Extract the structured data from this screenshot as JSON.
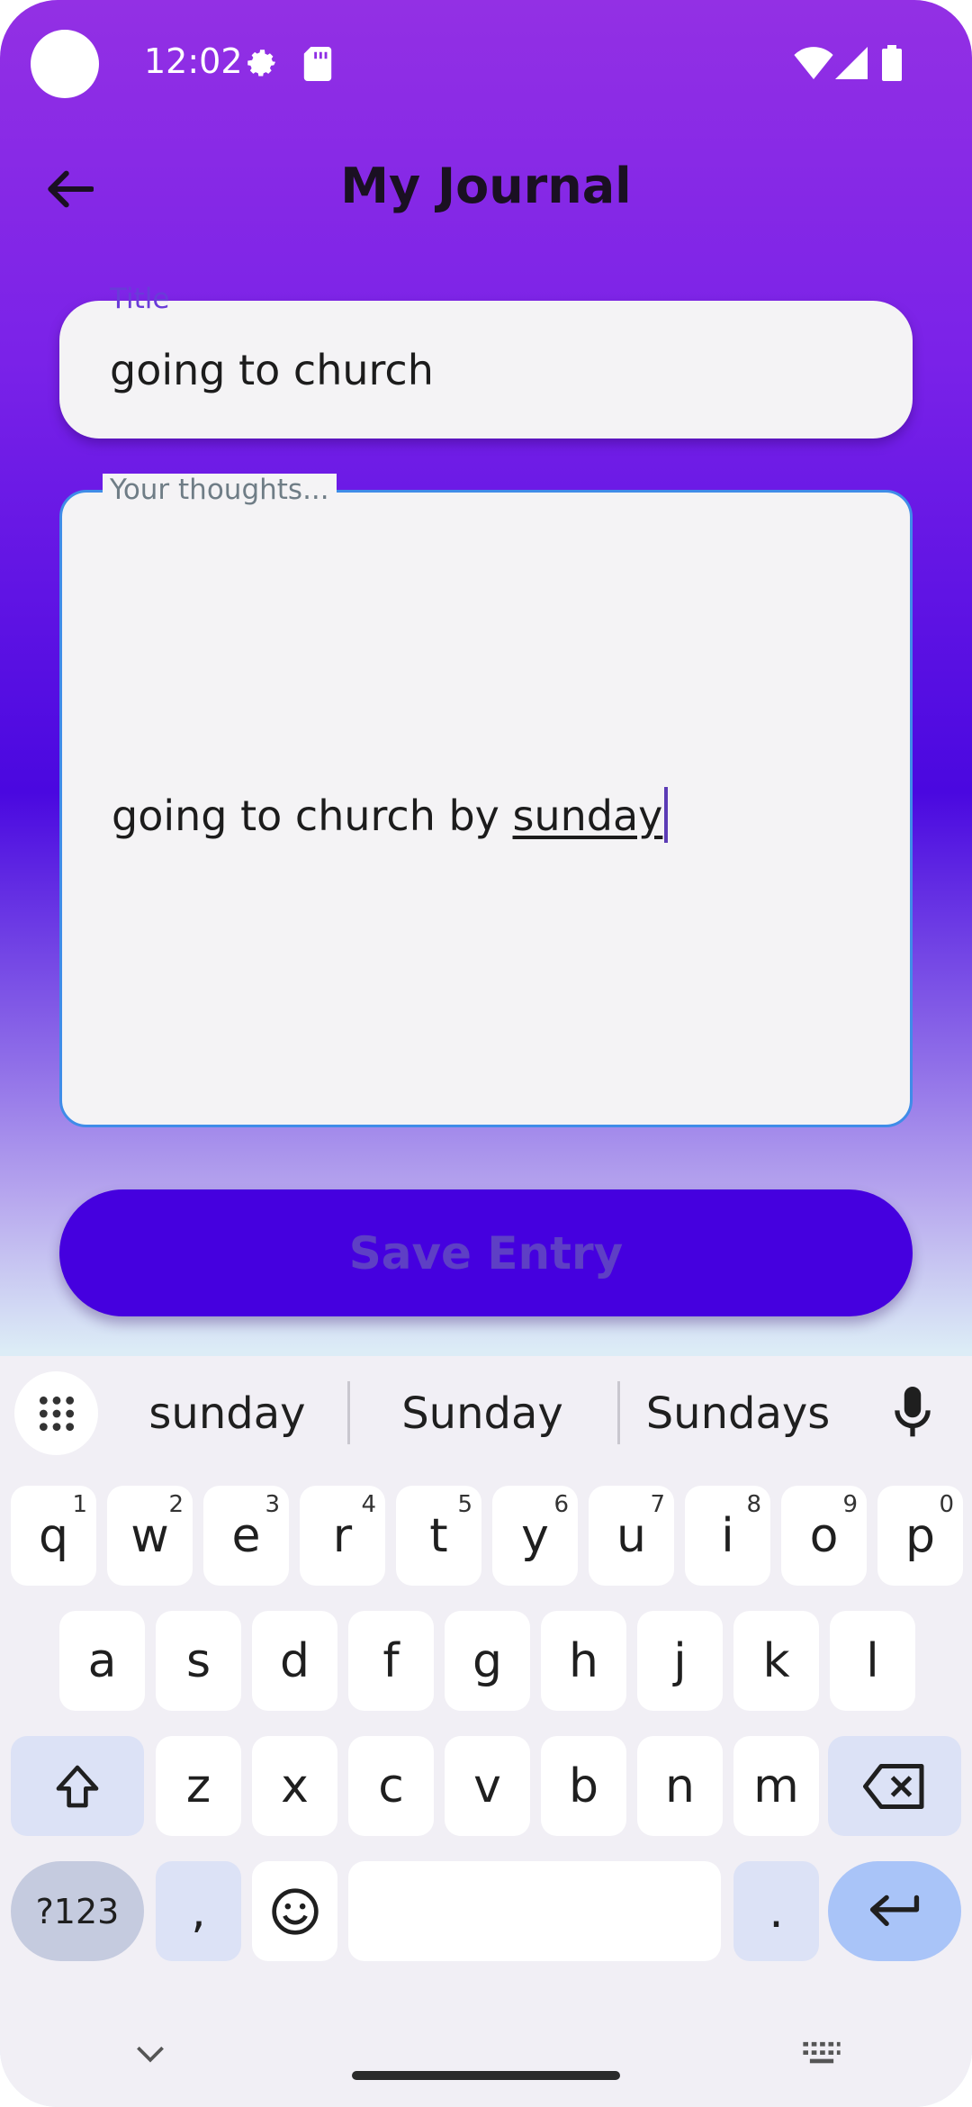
{
  "status_bar": {
    "time": "12:02"
  },
  "app_bar": {
    "title": "My Journal"
  },
  "form": {
    "title_label": "Title",
    "title_value": "going to church",
    "thoughts_label": "Your thoughts...",
    "thoughts_prefix": "going to church by ",
    "thoughts_composing": "sunday",
    "save_label": "Save Entry"
  },
  "keyboard": {
    "suggestions": [
      "sunday",
      "Sunday",
      "Sundays"
    ],
    "row1": [
      {
        "k": "q",
        "h": "1"
      },
      {
        "k": "w",
        "h": "2"
      },
      {
        "k": "e",
        "h": "3"
      },
      {
        "k": "r",
        "h": "4"
      },
      {
        "k": "t",
        "h": "5"
      },
      {
        "k": "y",
        "h": "6"
      },
      {
        "k": "u",
        "h": "7"
      },
      {
        "k": "i",
        "h": "8"
      },
      {
        "k": "o",
        "h": "9"
      },
      {
        "k": "p",
        "h": "0"
      }
    ],
    "row2": [
      "a",
      "s",
      "d",
      "f",
      "g",
      "h",
      "j",
      "k",
      "l"
    ],
    "row3": [
      "z",
      "x",
      "c",
      "v",
      "b",
      "n",
      "m"
    ],
    "symbols_label": "?123",
    "comma": ",",
    "period": "."
  },
  "colors": {
    "accent": "#4500df",
    "header": "#9330e4"
  }
}
